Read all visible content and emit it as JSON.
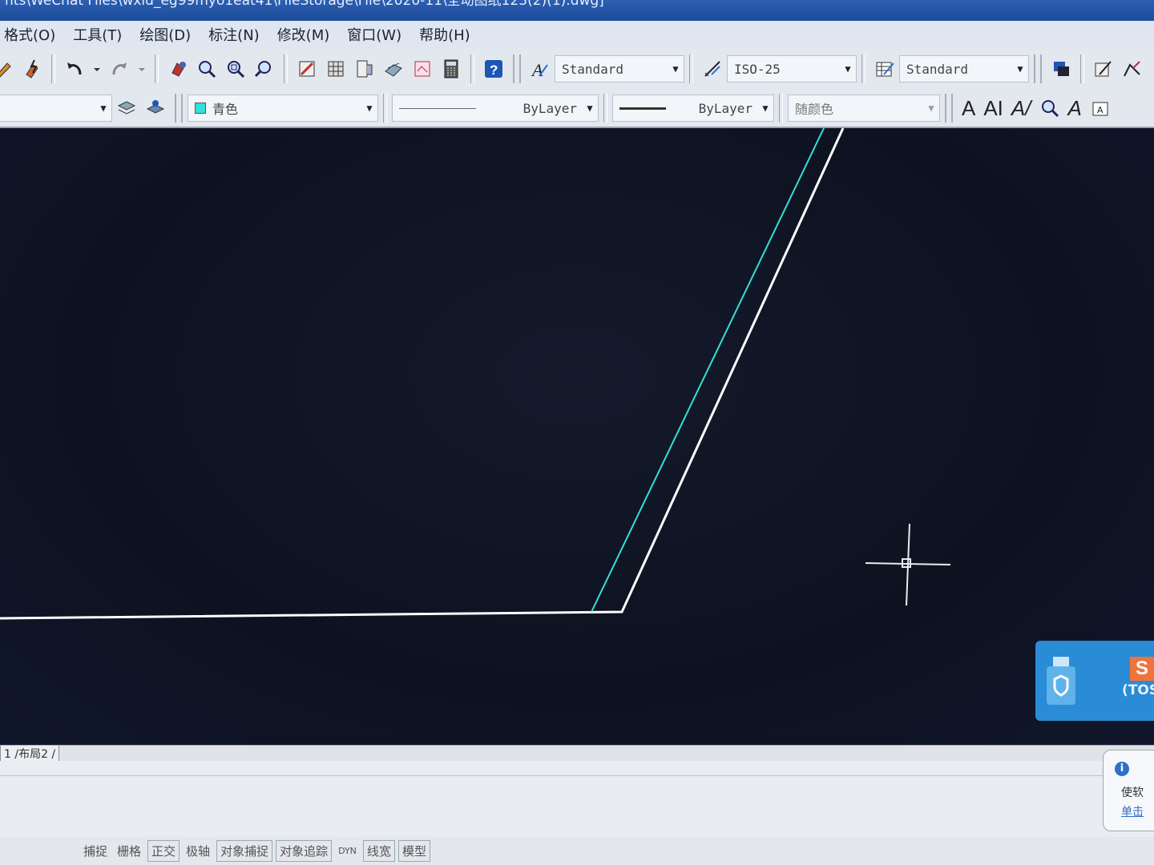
{
  "window": {
    "title": "nts\\WeChat Files\\wxid_eg99myo1eat41\\FileStorage\\File\\2020-11\\全动图纸123(2)(1).dwg]"
  },
  "menu": {
    "items": [
      "格式(O)",
      "工具(T)",
      "绘图(D)",
      "标注(N)",
      "修改(M)",
      "窗口(W)",
      "帮助(H)"
    ]
  },
  "styles_toolbar": {
    "text_style": "Standard",
    "dim_style": "ISO-25",
    "table_style": "Standard"
  },
  "properties_toolbar": {
    "color": "青色",
    "linetype": "ByLayer",
    "lineweight": "ByLayer",
    "plot_style": "随颜色",
    "color_hex": "#33e0d8"
  },
  "canvas": {
    "background": "#0f1523",
    "line_color_white": "#ffffff",
    "line_color_cyan": "#33e0d8"
  },
  "tray": {
    "text": "(TOS"
  },
  "tabs": {
    "layout": "1 /布局2 /"
  },
  "statusbar": {
    "items": [
      "捕捉",
      "栅格",
      "正交",
      "极轴",
      "对象捕捉",
      "对象追踪",
      "DYN",
      "线宽",
      "模型"
    ]
  },
  "notification": {
    "line1": "使软",
    "line2": "单击"
  },
  "icons": [
    "undo-icon",
    "redo-icon",
    "pan-icon",
    "zoom-realtime-icon",
    "zoom-window-icon",
    "zoom-previous-icon",
    "properties-icon",
    "design-center-icon",
    "tool-palette-icon",
    "sheetset-icon",
    "markup-icon",
    "calculator-icon",
    "help-icon",
    "text-style-icon",
    "dim-style-icon",
    "table-style-icon",
    "layer-icon",
    "text-icon"
  ]
}
